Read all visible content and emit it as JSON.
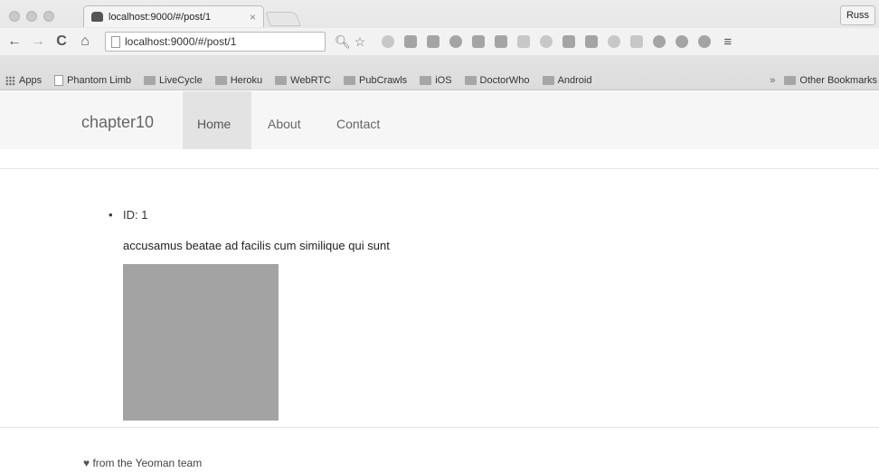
{
  "browser": {
    "tab_title": "localhost:9000/#/post/1",
    "tab_close": "×",
    "profile_name": "Russ",
    "url": "localhost:9000/#/post/1",
    "nav": {
      "back": "←",
      "forward": "→",
      "reload": "C",
      "home": "⌂"
    },
    "menu_glyph": "≡",
    "bookmarks": [
      {
        "label": "Apps",
        "icon": "apps-grid-icon"
      },
      {
        "label": "Phantom Limb",
        "icon": "page-icon"
      },
      {
        "label": "LiveCycle",
        "icon": "folder-icon"
      },
      {
        "label": "Heroku",
        "icon": "folder-icon"
      },
      {
        "label": "WebRTC",
        "icon": "folder-icon"
      },
      {
        "label": "PubCrawls",
        "icon": "folder-icon"
      },
      {
        "label": "iOS",
        "icon": "folder-icon"
      },
      {
        "label": "DoctorWho",
        "icon": "folder-icon"
      },
      {
        "label": "Android",
        "icon": "folder-icon"
      }
    ],
    "bookmarks_overflow": "»",
    "other_bookmarks": "Other Bookmarks"
  },
  "app": {
    "brand": "chapter10",
    "nav": {
      "home": "Home",
      "about": "About",
      "contact": "Contact"
    }
  },
  "post": {
    "id_label": "ID: 1",
    "bullet": "•",
    "title": "accusamus beatae ad facilis cum similique qui sunt"
  },
  "footer": {
    "heart": "♥",
    "text": "from the Yeoman team"
  }
}
